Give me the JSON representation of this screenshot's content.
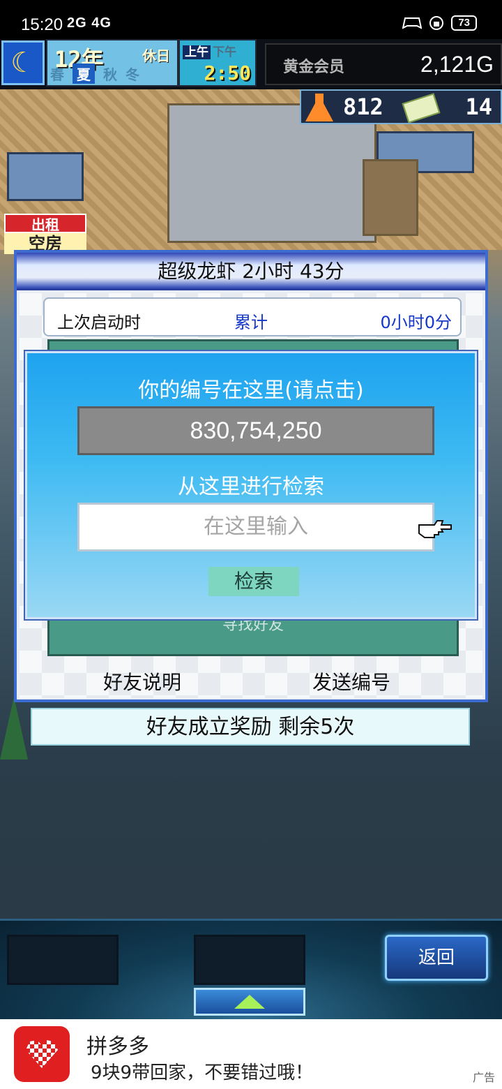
{
  "status_bar": {
    "time": "15:20",
    "network": "2G 4G",
    "network_icons": [
      "signal-2g-icon",
      "signal-4g-icon",
      "wifi-icon",
      "hd-icon"
    ],
    "right_icons": [
      "game-controller-icon",
      "lock-rotation-icon"
    ],
    "battery": "73"
  },
  "hud": {
    "year": "12年",
    "holiday": "休日",
    "seasons": [
      "春",
      "夏",
      "秋",
      "冬"
    ],
    "active_season": "夏",
    "am": "上午",
    "pm": "下午",
    "clock": "2:50",
    "member": "黄金会员",
    "gold": "2,121G",
    "research": "812",
    "tickets": "14"
  },
  "scene": {
    "rent_label": "出租",
    "vacant_label": "空房"
  },
  "dialog": {
    "title": "超级龙虾 2小时 43分",
    "last_login_label": "上次启动时",
    "total_label": "累计",
    "total_value": "0小时0分",
    "hidden_text": "寻找好友",
    "link_friend_info": "好友说明",
    "link_send_code": "发送编号",
    "reward_text": "好友成立奖励 剩余5次"
  },
  "code_dialog": {
    "your_code_label": "你的编号在这里(请点击)",
    "your_code": "830,754,250",
    "search_label": "从这里进行检索",
    "input_placeholder": "在这里输入",
    "search_button": "检索"
  },
  "game_nav": {
    "return_button": "返回"
  },
  "ad": {
    "app_name": "拼多多",
    "slogan": "9块9带回家，不要错过哦！",
    "tag": "广告"
  },
  "colors": {
    "dialog_border": "#3d6bd0",
    "code_dialog_top": "#1fa3ef",
    "green_panel": "#4a9a88",
    "blue_text": "#1438c9",
    "ad_red": "#e02020"
  }
}
